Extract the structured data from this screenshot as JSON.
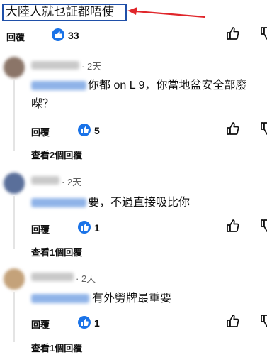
{
  "top_comment": {
    "text": "大陸人就乜証都唔使",
    "reply_label": "回覆",
    "like_count": "33"
  },
  "replies": [
    {
      "time": "· 2天",
      "text_line1": "你都 on L 9，你當地盆安全部廢",
      "text_line2": "㗎？",
      "reply_label": "回覆",
      "like_count": "5",
      "view_replies": "查看2個回覆"
    },
    {
      "time": "· 2天",
      "text_line1": "要，不過直接吸比你",
      "reply_label": "回覆",
      "like_count": "1",
      "view_replies": "查看1個回覆"
    },
    {
      "time": "· 2天",
      "text_line1": "有外勞牌最重要",
      "reply_label": "回覆",
      "like_count": "1",
      "view_replies": "查看1個回覆"
    }
  ],
  "colors": {
    "highlight_box": "#1f4fa8",
    "arrow": "#e0262b",
    "like_badge": "#1a73e8",
    "mention_blur": "#8fb3e8",
    "meta_text": "#606060"
  },
  "icons": [
    "thumbs-up-filled-icon",
    "thumbs-up-outline-icon",
    "thumbs-down-outline-icon",
    "red-arrow-annotation"
  ]
}
